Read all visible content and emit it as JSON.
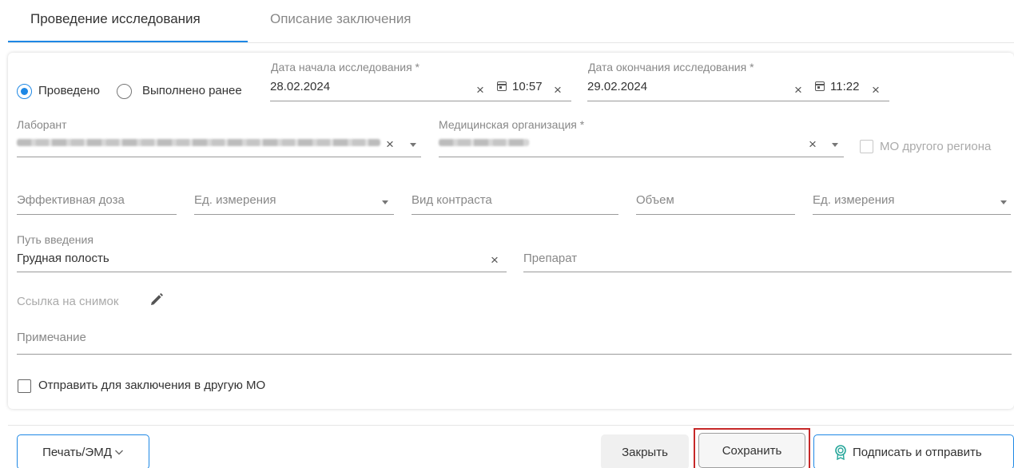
{
  "tabs": [
    {
      "label": "Проведение исследования",
      "active": true
    },
    {
      "label": "Описание заключения",
      "active": false
    }
  ],
  "status": {
    "option_done": "Проведено",
    "option_done_earlier": "Выполнено ранее",
    "selected": "Проведено"
  },
  "start": {
    "label": "Дата начала исследования *",
    "date": "28.02.2024",
    "time": "10:57"
  },
  "end": {
    "label": "Дата окончания исследования *",
    "date": "29.02.2024",
    "time": "11:22"
  },
  "lab": {
    "label": "Лаборант",
    "value_redacted": "ФЛ - Иванов Петр Сергеевич (Терапевты, Кабинет врача-т"
  },
  "org": {
    "label": "Медицинская организация *",
    "value_redacted": "024024 - 1111",
    "other_region_label": "МО другого региона"
  },
  "dose": {
    "effective_dose": "Эффективная доза",
    "unit1": "Ед. измерения",
    "contrast_type": "Вид контраста",
    "volume": "Объем",
    "unit2": "Ед. измерения"
  },
  "route": {
    "label": "Путь введения",
    "value": "Грудная полость",
    "drug_placeholder": "Препарат"
  },
  "image_link": {
    "label": "Ссылка на снимок",
    "icon": "pencil-icon"
  },
  "note": {
    "placeholder": "Примечание"
  },
  "send_other_mo": {
    "label": "Отправить для заключения в другую МО",
    "checked": false
  },
  "footer": {
    "print_label": "Печать/ЭМД",
    "close_label": "Закрыть",
    "save_label": "Сохранить",
    "sign_label": "Подписать и отправить"
  },
  "colors": {
    "accent": "#1e88e5",
    "highlight": "#c62828"
  }
}
